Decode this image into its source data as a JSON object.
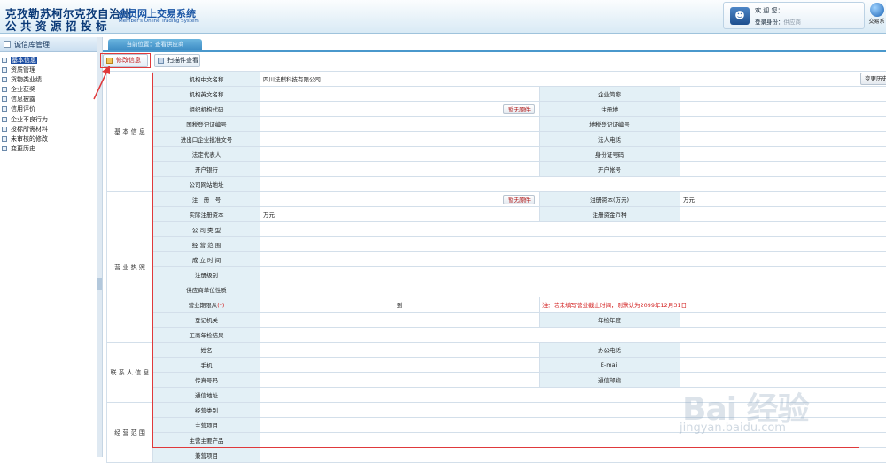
{
  "header": {
    "logo_line1": "克孜勒苏柯尔克孜自治州",
    "logo_line2": "公共资源招投标",
    "system_title": "会员网上交易系统",
    "system_subtitle": "Member's Online Trading System",
    "welcome": "欢 迎 您：",
    "login_id_label": "登录身份：",
    "login_id_value": "供应商",
    "trade_button": "交易系"
  },
  "sidebar": {
    "title": "诚信库管理",
    "items": [
      {
        "label": "基本信息",
        "active": true
      },
      {
        "label": "资质管理"
      },
      {
        "label": "货物类业绩"
      },
      {
        "label": "企业获奖"
      },
      {
        "label": "信息披露"
      },
      {
        "label": "信用评价"
      },
      {
        "label": "企业不良行为"
      },
      {
        "label": "投标所需材料"
      },
      {
        "label": "未审核的修改"
      },
      {
        "label": "变更历史"
      }
    ]
  },
  "main": {
    "breadcrumb": "当前位置：查看供应商",
    "edit_button": "修改信息",
    "scan_button": "扫描件查看",
    "history_button": "变更历史",
    "no_original": "暂无原件"
  },
  "form": {
    "sections": {
      "basic": "基 本 信 息",
      "license": "营 业 执 照",
      "contact": "联 系 人 信 息",
      "scope": "经 营 范 围"
    },
    "labels": {
      "org_cn_name": "机构中文名称",
      "org_en_name": "机构英文名称",
      "short_name": "企业简称",
      "org_code": "组织机构代码",
      "reg_place": "注册地",
      "national_tax": "国税登记证编号",
      "local_tax": "地税登记证编号",
      "import_export": "进出口企业批准文号",
      "legal_phone": "法人电话",
      "legal_rep": "法定代表人",
      "id_number": "身份证号码",
      "bank": "开户银行",
      "account": "开户帐号",
      "website": "公司网站地址",
      "reg_no": "注　册　号",
      "reg_capital": "注册资本(万元)",
      "paid_capital": "实际注册资本",
      "capital_currency": "注册资金币种",
      "company_type": "公 司 类 型",
      "business_scope": "经 营 范 围",
      "establish_time": "成 立 时 间",
      "reg_level": "注册级别",
      "supplier_type": "供应商单位性质",
      "license_period": "营业期限从(*)",
      "reg_authority": "登记机关",
      "annual_check_year": "年检年度",
      "annual_check_result": "工商年检结果",
      "name": "姓名",
      "office_phone": "办公电话",
      "mobile": "手机",
      "email": "E-mail",
      "fax": "传真号码",
      "postcode": "通信邮编",
      "address": "通信地址",
      "business_category": "经营类别",
      "main_items": "主营项目",
      "main_products": "主营主要产品",
      "side_items": "兼营项目"
    },
    "values": {
      "org_cn_name": "四川法麒科技有限公司",
      "reg_capital_unit": "万元",
      "paid_capital_unit": "万元",
      "period_to": "到",
      "period_note": "注：若未填写营业截止时间，则默认为2099年12月31日"
    }
  },
  "watermark": {
    "logo": "Bai 经验",
    "url": "jingyan.baidu.com"
  }
}
